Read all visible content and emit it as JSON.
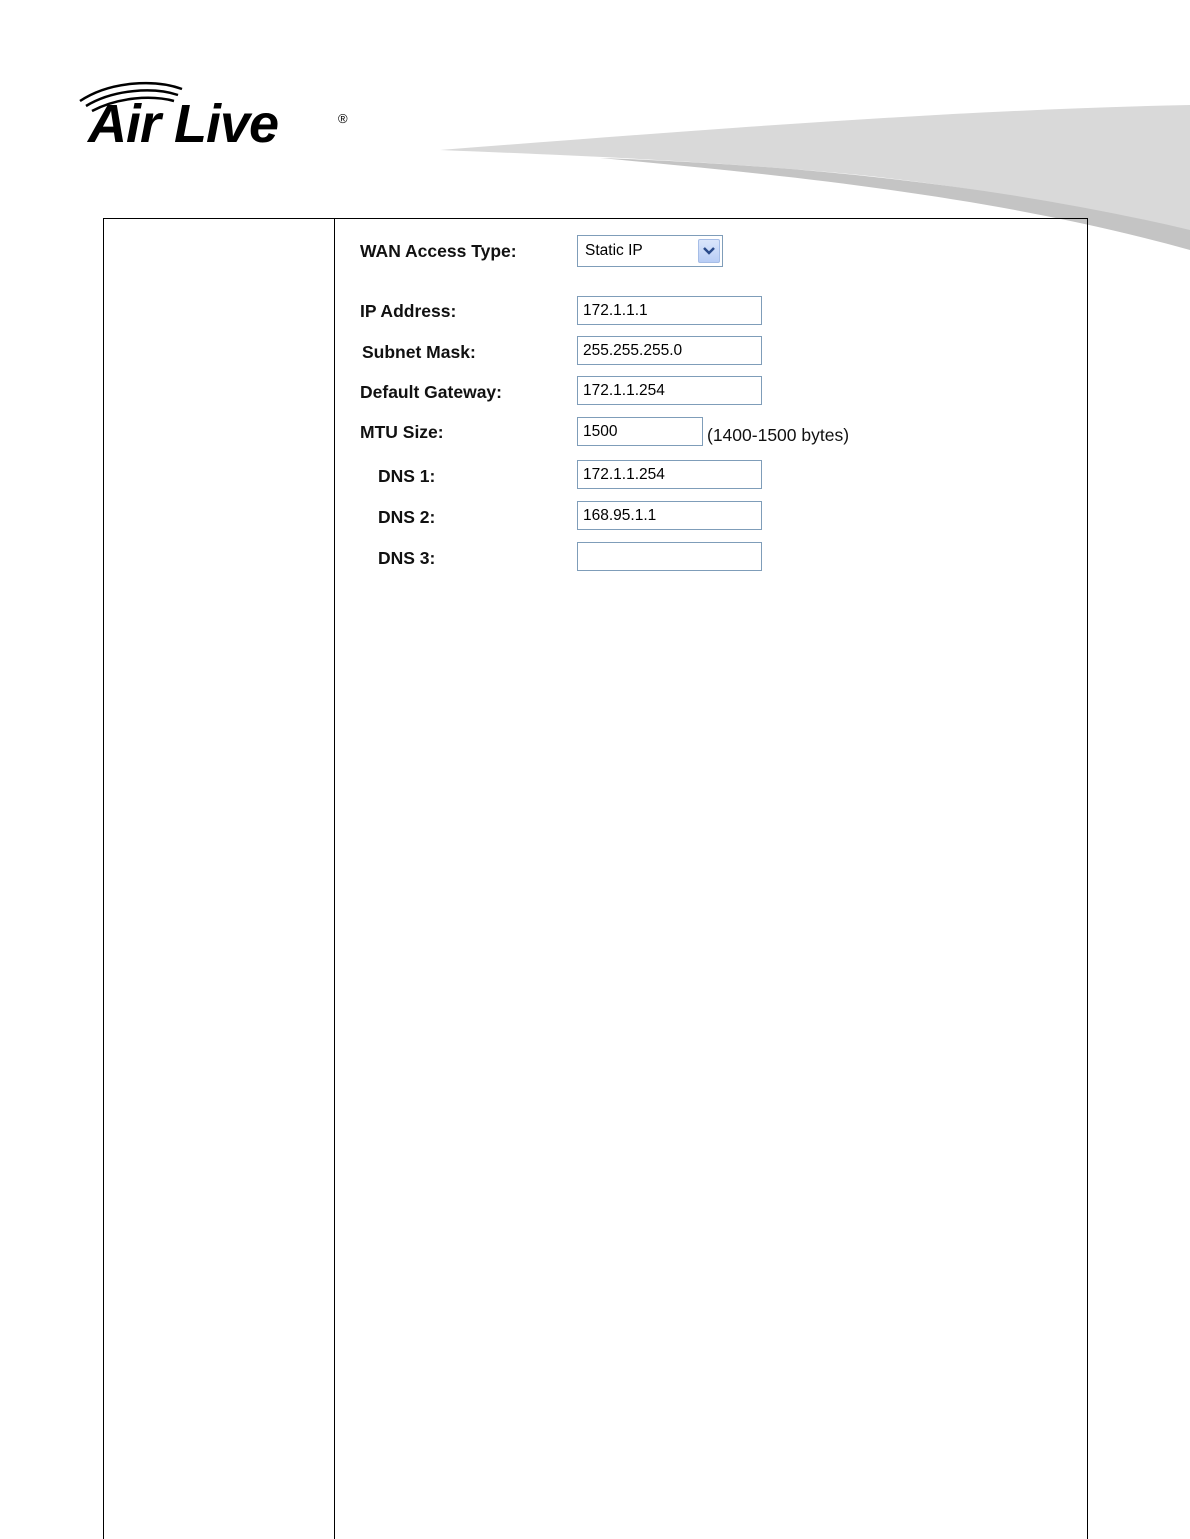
{
  "header": {
    "logo_text": "Air Live",
    "logo_registered_mark": "®"
  },
  "form": {
    "wan_access_type": {
      "label": "WAN Access Type:",
      "value": "Static IP"
    },
    "ip_address": {
      "label": "IP Address:",
      "value": "172.1.1.1"
    },
    "subnet_mask": {
      "label": "Subnet Mask:",
      "value": "255.255.255.0"
    },
    "default_gateway": {
      "label": "Default Gateway:",
      "value": "172.1.1.254"
    },
    "mtu_size": {
      "label": "MTU Size:",
      "value": "1500",
      "hint": "(1400-1500 bytes)"
    },
    "dns1": {
      "label": "DNS 1:",
      "value": "172.1.1.254"
    },
    "dns2": {
      "label": "DNS 2:",
      "value": "168.95.1.1"
    },
    "dns3": {
      "label": "DNS 3:",
      "value": ""
    }
  },
  "colors": {
    "field_border": "#7f9db9",
    "swoosh_gray": "#cfcfcf"
  }
}
